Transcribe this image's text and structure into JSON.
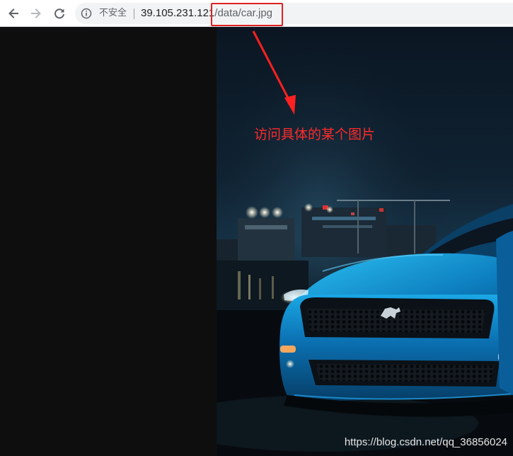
{
  "browser": {
    "back_icon": "arrow-left-icon",
    "forward_icon": "arrow-right-icon",
    "reload_icon": "reload-icon",
    "info_icon": "info-icon",
    "security_label": "不安全",
    "url_host": "39.105.231.121",
    "url_path": "/data/car.jpg"
  },
  "annotation": {
    "text": "访问具体的某个图片",
    "color": "#ff2a2a"
  },
  "content": {
    "image_description": "blue-sports-car-photo",
    "watermark": "https://blog.csdn.net/qq_36856024"
  }
}
